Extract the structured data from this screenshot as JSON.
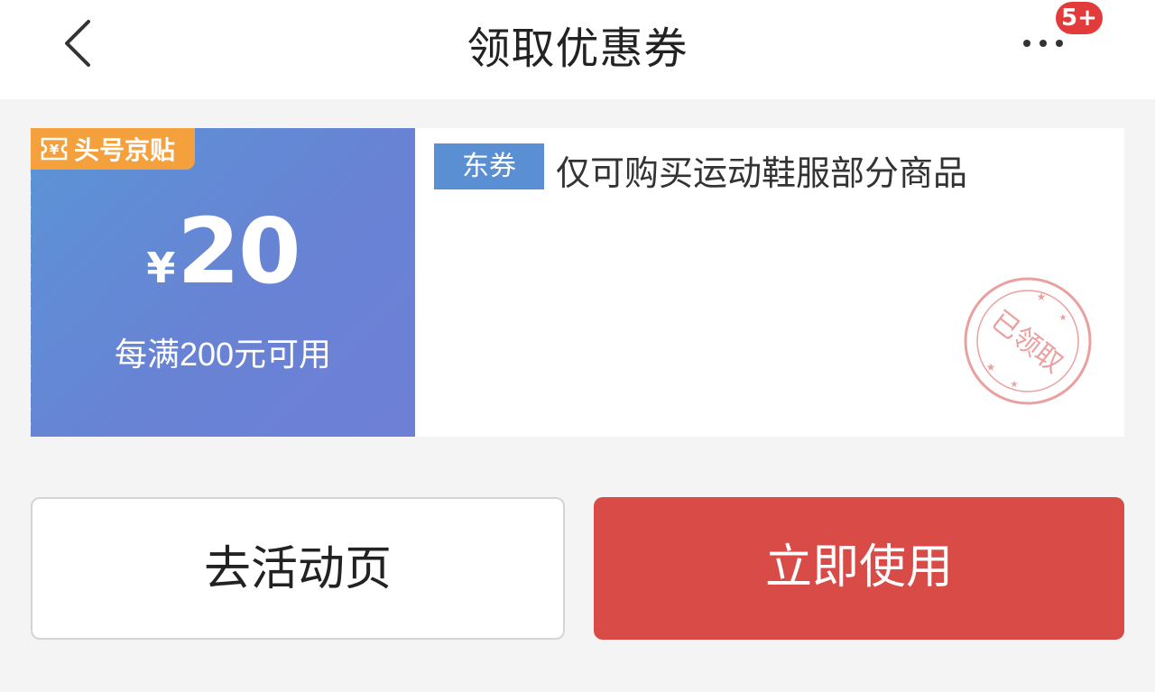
{
  "header": {
    "title": "领取优惠券",
    "notification_badge": "5+"
  },
  "coupon": {
    "tag_label": "头号京贴",
    "currency_symbol": "¥",
    "amount": "20",
    "condition": "每满200元可用",
    "type_label": "东券",
    "description": "仅可购买运动鞋服部分商品",
    "stamp_text": "已领取"
  },
  "actions": {
    "activity_label": "去活动页",
    "use_label": "立即使用"
  },
  "colors": {
    "accent_red": "#d94b47",
    "coupon_blue": "#6883d4",
    "tag_orange": "#f4a13d",
    "type_badge_blue": "#5b8fd3",
    "stamp_pink": "#eba0a0"
  }
}
